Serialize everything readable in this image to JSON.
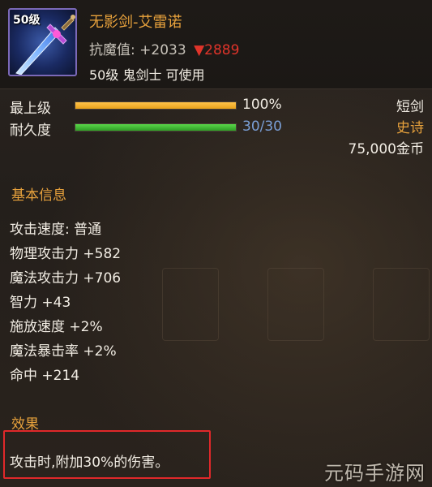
{
  "item": {
    "level_badge": "50级",
    "name": "无影剑-艾雷诺",
    "stat_label": "抗魔值:",
    "stat_value": "+2033",
    "stat_compare_arrow": "▼",
    "stat_compare_value": "2889",
    "requirement": "50级 鬼剑士 可使用",
    "icon": "sword-icon"
  },
  "bars": [
    {
      "label": "最上级",
      "value_text": "100%",
      "fill": 1.0,
      "color": "#e8a21c",
      "value_color": "#f2ede4"
    },
    {
      "label": "耐久度",
      "value_text": "30/30",
      "fill": 1.0,
      "color": "#3fb52f",
      "value_color": "#7a9fd6"
    }
  ],
  "right_info": {
    "type": "短剑",
    "rarity": "史诗",
    "price": "75,000金币"
  },
  "basic_info": {
    "title": "基本信息",
    "attributes": [
      "攻击速度: 普通",
      "物理攻击力 +582",
      "魔法攻击力 +706",
      "智力 +43",
      "施放速度 +2%",
      "魔法暴击率 +2%",
      "命中 +214"
    ]
  },
  "effect": {
    "title": "效果",
    "text": "攻击时,附加30%的伤害。"
  },
  "watermark": "元码手游网",
  "colors": {
    "gold": "#e8a23c",
    "rarity": "#e8a23c",
    "decrease": "#e0342a",
    "highlight_box": "#e0282a"
  }
}
